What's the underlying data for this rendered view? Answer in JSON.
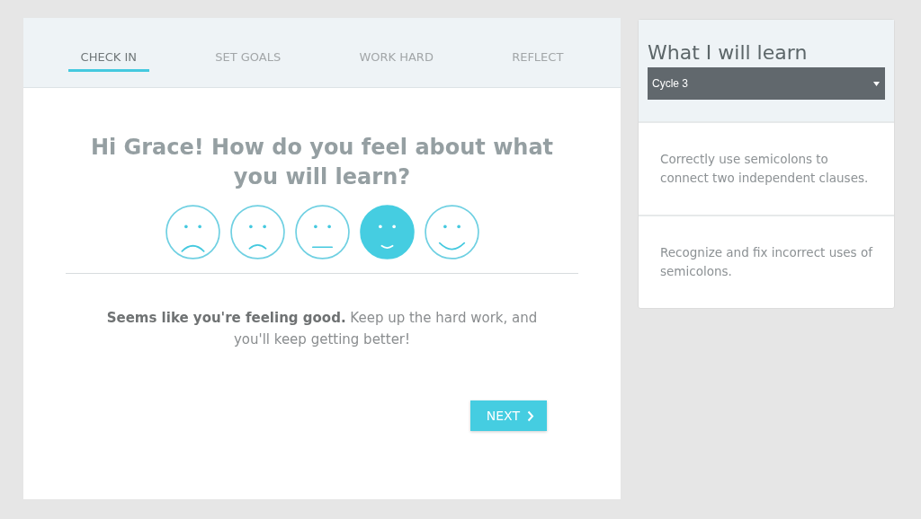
{
  "tabs": [
    {
      "label": "CHECK IN",
      "selected": true
    },
    {
      "label": "SET GOALS",
      "selected": false
    },
    {
      "label": "WORK HARD",
      "selected": false
    },
    {
      "label": "REFLECT",
      "selected": false
    }
  ],
  "question": "Hi Grace! How do you feel about what you will learn?",
  "moods": [
    {
      "kind": "very-sad",
      "selected": false
    },
    {
      "kind": "sad",
      "selected": false
    },
    {
      "kind": "neutral",
      "selected": false
    },
    {
      "kind": "happy",
      "selected": true
    },
    {
      "kind": "very-happy",
      "selected": false
    }
  ],
  "feedback": "**Seems like you're feeling good.** Keep up the hard work, and you'll keep getting better!",
  "next_button": "NEXT",
  "sidebar": {
    "title": "What I will learn",
    "cycle_select": {
      "value": "Cycle 3"
    },
    "goals": [
      "Correctly use semicolons to connect two independent clauses.",
      "Recognize and fix incorrect uses of semicolons."
    ]
  }
}
